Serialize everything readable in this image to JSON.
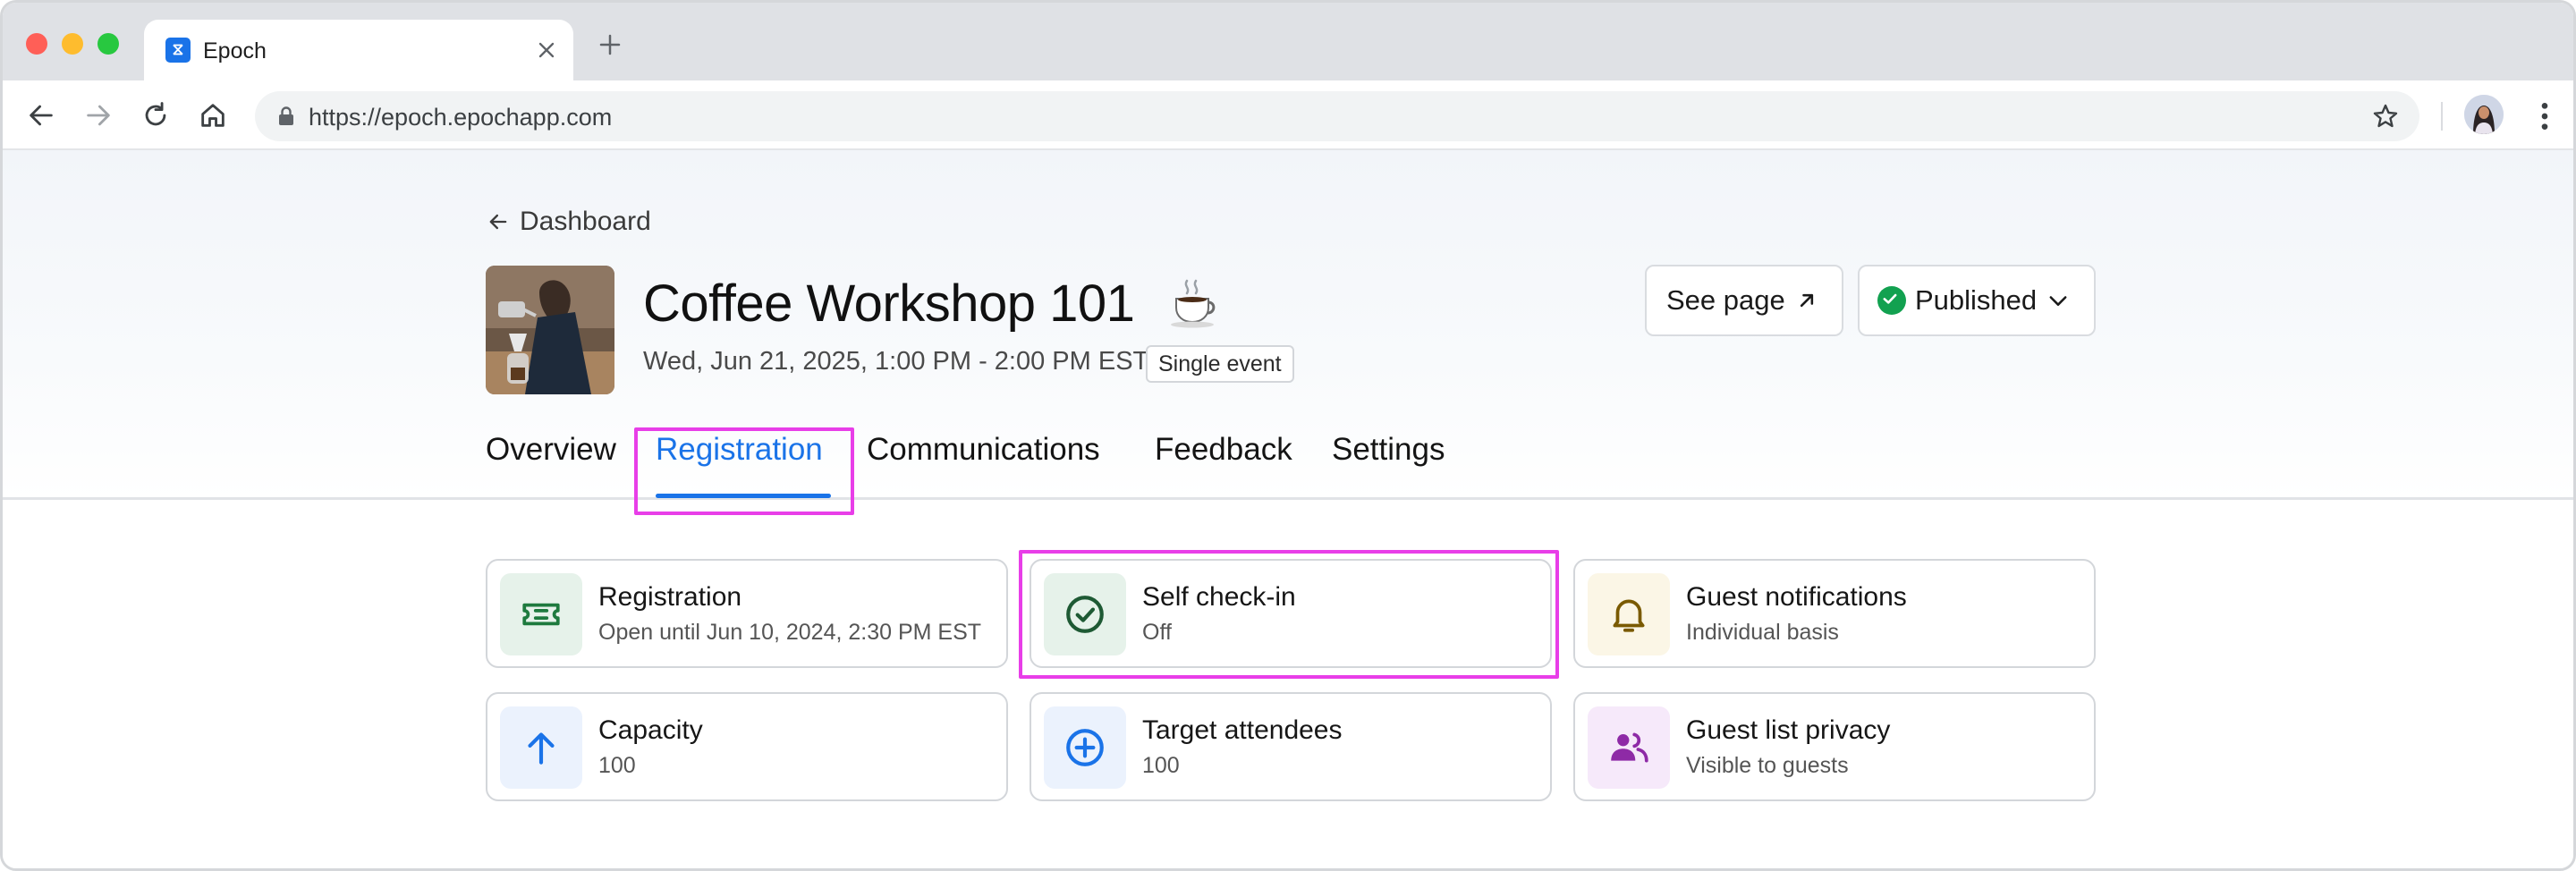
{
  "browser": {
    "tab_title": "Epoch",
    "url": "https://epoch.epochapp.com"
  },
  "header": {
    "back_label": "Dashboard",
    "title": "Coffee Workshop 101",
    "title_emoji": "coffee-cup",
    "datetime": "Wed, Jun 21, 2025, 1:00 PM - 2:00 PM EST",
    "badge": "Single event",
    "see_page_label": "See page",
    "status_label": "Published"
  },
  "tabs": [
    {
      "label": "Overview",
      "active": false
    },
    {
      "label": "Registration",
      "active": true
    },
    {
      "label": "Communications",
      "active": false
    },
    {
      "label": "Feedback",
      "active": false
    },
    {
      "label": "Settings",
      "active": false
    }
  ],
  "cards": [
    {
      "title": "Registration",
      "subtitle": "Open until Jun 10, 2024, 2:30 PM EST",
      "icon": "ticket-icon",
      "color": "#1e7a3e"
    },
    {
      "title": "Self check-in",
      "subtitle": "Off",
      "icon": "check-circle-icon",
      "color": "#1e7a3e"
    },
    {
      "title": "Guest notifications",
      "subtitle": "Individual basis",
      "icon": "bell-icon",
      "color": "#8a6100"
    },
    {
      "title": "Capacity",
      "subtitle": "100",
      "icon": "arrow-up-icon",
      "color": "#1a73e8"
    },
    {
      "title": "Target attendees",
      "subtitle": "100",
      "icon": "plus-circle-icon",
      "color": "#1a73e8"
    },
    {
      "title": "Guest list privacy",
      "subtitle": "Visible to guests",
      "icon": "people-icon",
      "color": "#9c2bb0"
    }
  ],
  "colors": {
    "accent": "#1a73e8",
    "highlight": "#e83ee8",
    "published": "#12a150"
  }
}
